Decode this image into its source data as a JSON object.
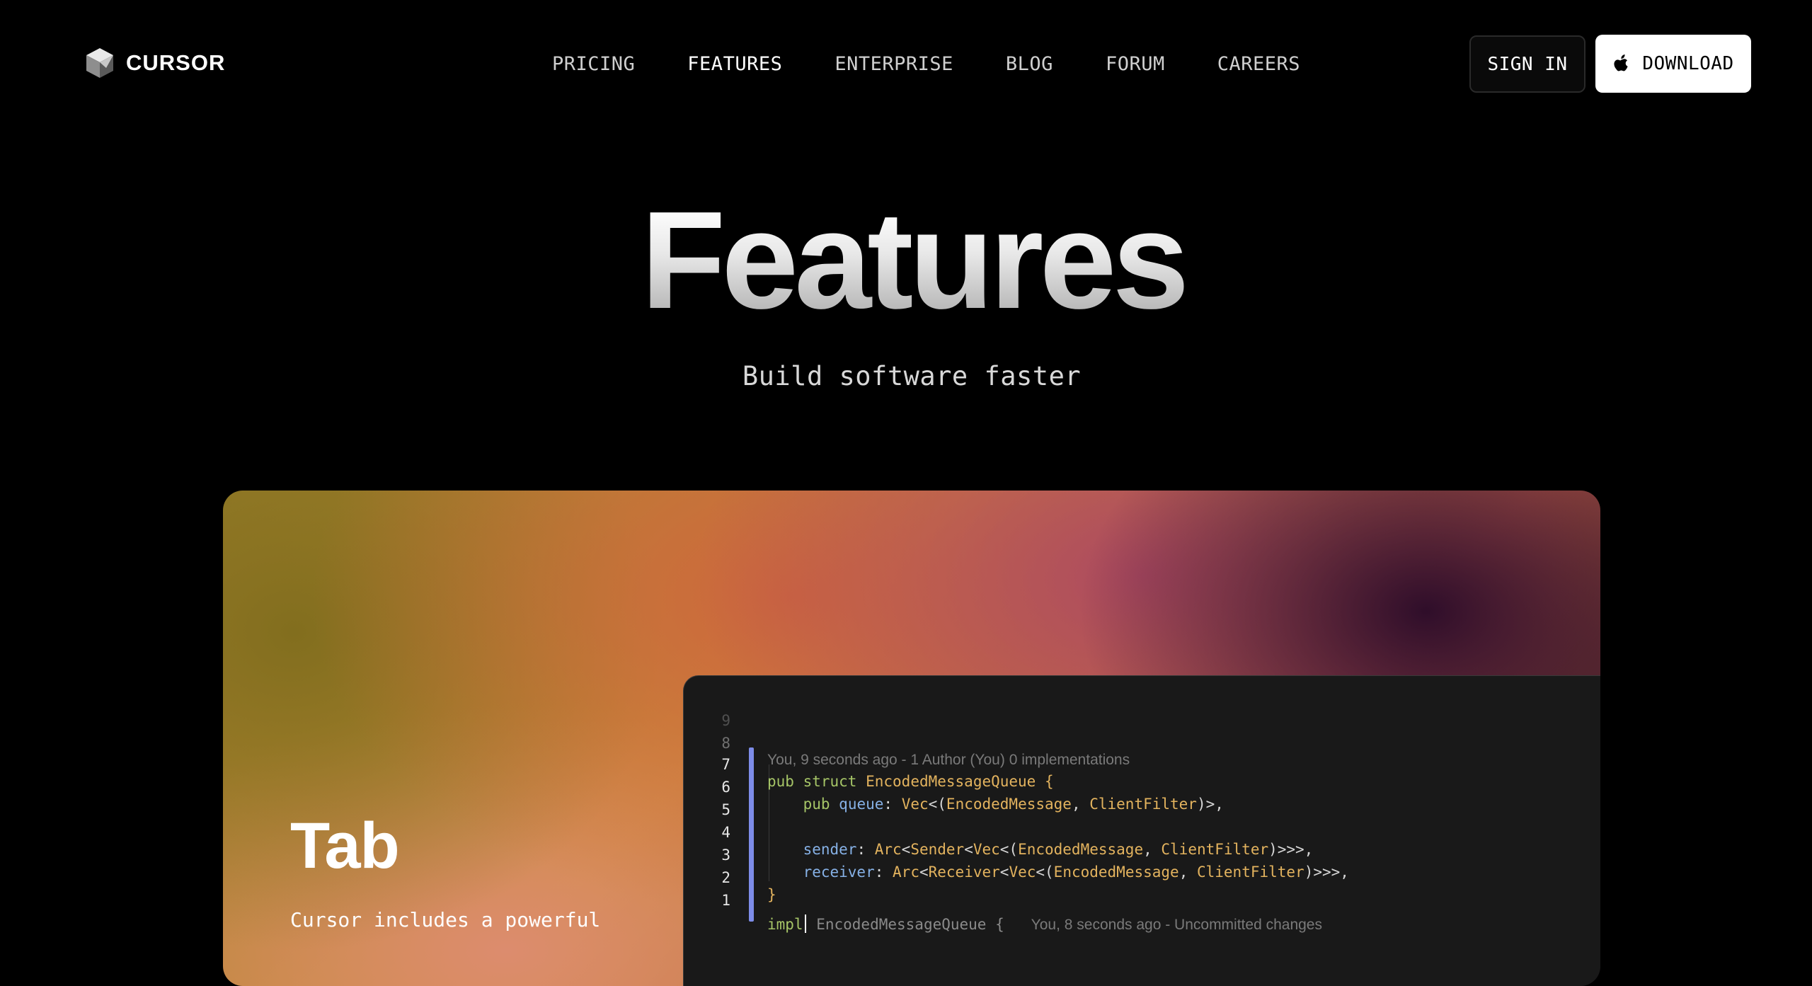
{
  "nav": {
    "logo_text": "CURSOR",
    "links": [
      {
        "label": "PRICING"
      },
      {
        "label": "FEATURES"
      },
      {
        "label": "ENTERPRISE"
      },
      {
        "label": "BLOG"
      },
      {
        "label": "FORUM"
      },
      {
        "label": "CAREERS"
      }
    ],
    "active_link": "FEATURES",
    "sign_in": "SIGN IN",
    "download": "DOWNLOAD"
  },
  "hero": {
    "title": "Features",
    "subtitle": "Build software faster"
  },
  "feature_card": {
    "title": "Tab",
    "description": "Cursor includes a powerful"
  },
  "editor": {
    "line_numbers": [
      "9",
      "8",
      "7",
      "6",
      "5",
      "4",
      "3",
      "2",
      "1"
    ],
    "blame_top": "You, 9 seconds ago - 1 Author (You) 0 implementations",
    "blame_bottom": "You, 8 seconds ago - Uncommitted changes",
    "tokens": {
      "pub": "pub",
      "struct": "struct",
      "name": "EncodedMessageQueue",
      "open_brace": " {",
      "queue_field": "queue",
      "sender_field": "sender",
      "receiver_field": "receiver",
      "vec": "Vec",
      "arc": "Arc",
      "sender_type": "Sender",
      "receiver_type": "Receiver",
      "encoded_message": "EncodedMessage",
      "client_filter": "ClientFilter",
      "close_brace": "}",
      "impl": "impl",
      "impl_rest": " EncodedMessageQueue {"
    }
  },
  "colors": {
    "background": "#000000",
    "editor_bg": "#191919",
    "keyword": "#a6c567",
    "type": "#e3b35e",
    "field": "#86b1e6",
    "gutter_bar": "#7d8ce8"
  },
  "icons": {
    "logo": "cursor-cube-logo-icon",
    "download": "apple-icon"
  }
}
